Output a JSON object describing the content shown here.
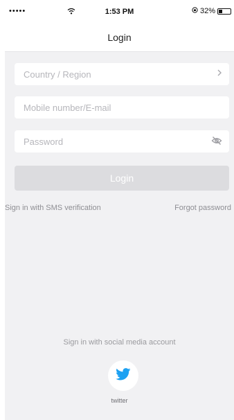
{
  "status_bar": {
    "signal": "•••••",
    "time": "1:53 PM",
    "battery_percent_label": "32%",
    "battery_level": 0.32
  },
  "nav": {
    "title": "Login"
  },
  "form": {
    "country_placeholder": "Country / Region",
    "account_placeholder": "Mobile number/E-mail",
    "password_placeholder": "Password",
    "login_label": "Login"
  },
  "links": {
    "sms_login": "Sign in with SMS verification",
    "forgot_password": "Forgot password"
  },
  "social": {
    "heading": "Sign in with social media account",
    "twitter_label": "twitter"
  },
  "colors": {
    "background": "#f1f1f3",
    "field": "#ffffff",
    "login_button": "#dcdcdf",
    "twitter_blue": "#1da1f2"
  },
  "icons": {
    "wifi": "wifi-icon",
    "battery": "battery-icon",
    "chevron": "chevron-right-icon",
    "password_toggle": "eye-slash-icon",
    "twitter": "twitter-bird-icon"
  }
}
